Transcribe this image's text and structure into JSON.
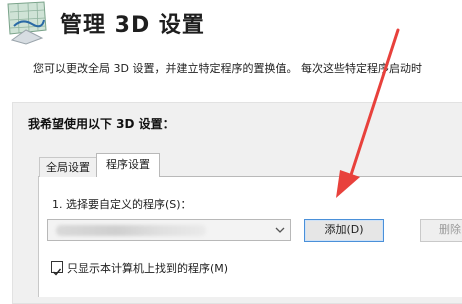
{
  "header": {
    "title": "管理 3D 设置",
    "logo_icon": "nvidia-3d-settings-icon"
  },
  "description": "您可以更改全局 3D 设置，并建立特定程序的置换值。 每次这些特定程序启动时",
  "panel": {
    "heading": "我希望使用以下 3D 设置："
  },
  "tabs": [
    {
      "label": "全局设置",
      "active": false
    },
    {
      "label": "程序设置",
      "active": true
    }
  ],
  "program_settings": {
    "select_label": "1. 选择要自定义的程序(S)：",
    "dropdown_value": "",
    "add_button": "添加(D)",
    "delete_button": "删除",
    "checkbox_label": "只显示本计算机上找到的程序(M)",
    "checkbox_checked": true
  },
  "annotation": {
    "arrow_color": "#e8413c"
  }
}
